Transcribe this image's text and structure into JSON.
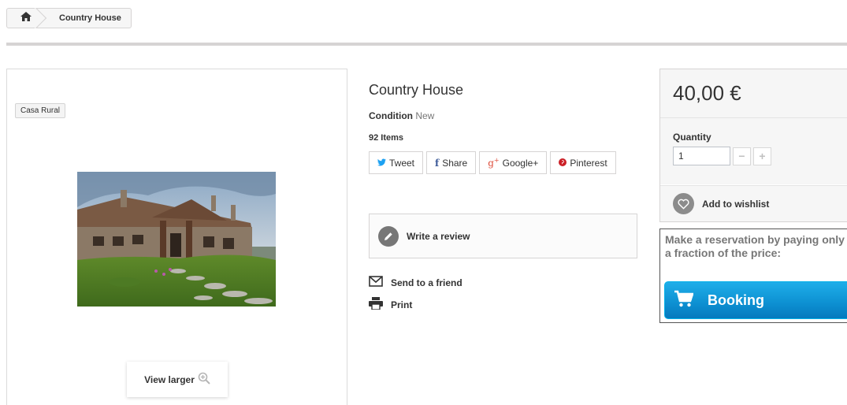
{
  "breadcrumb": {
    "home_icon": "home-icon",
    "current": "Country House"
  },
  "product": {
    "badge": "Casa Rural",
    "title": "Country House",
    "condition_label": "Condition",
    "condition_value": "New",
    "items": "92 Items",
    "view_larger": "View larger"
  },
  "social": {
    "tweet": "Tweet",
    "share": "Share",
    "google": "Google+",
    "pinterest": "Pinterest"
  },
  "actions": {
    "write_review": "Write a review",
    "send_to_friend": "Send to a friend",
    "print": "Print"
  },
  "buy": {
    "price": "40,00 €",
    "quantity_label": "Quantity",
    "quantity_value": "1",
    "minus": "−",
    "plus": "+",
    "wishlist": "Add to wishlist",
    "reservation_text": "Make a reservation by paying only a fraction of the price:",
    "booking": "Booking"
  },
  "colors": {
    "twitter": "#1da1f2",
    "facebook": "#3b5998",
    "google": "#dd4b39",
    "pinterest": "#cb2027",
    "booking_blue": "#0e92d3"
  }
}
